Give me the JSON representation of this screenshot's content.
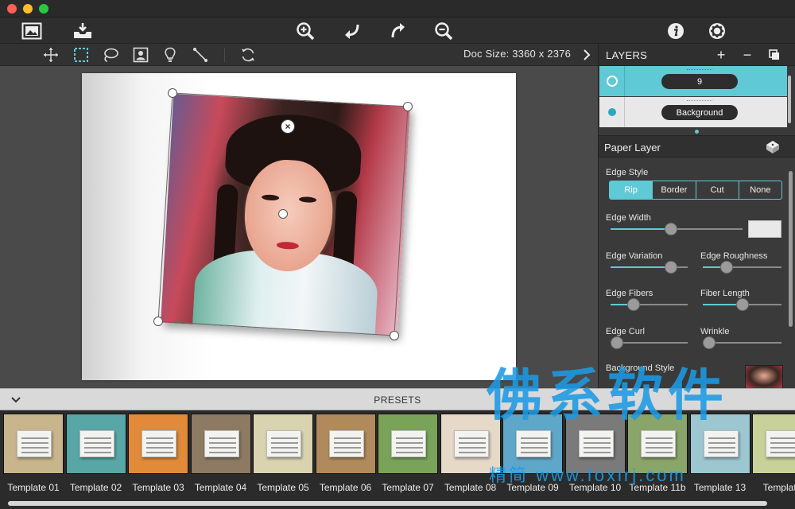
{
  "toolbar": {
    "left_icons": [
      "photo-frame-icon",
      "tray-download-icon"
    ],
    "center_icons": [
      "zoom-in-icon",
      "undo-icon",
      "redo-icon",
      "zoom-out-icon"
    ],
    "right_icons": [
      "info-icon",
      "gear-icon"
    ]
  },
  "subbar": {
    "tools": [
      "move-icon",
      "rect-select-icon",
      "lasso-icon",
      "person-frame-icon",
      "lightbulb-icon",
      "line-icon",
      "rotate-icon"
    ],
    "doc_size_label": "Doc Size:",
    "doc_size_value": "3360 x 2376"
  },
  "layers": {
    "title": "LAYERS",
    "add": "+",
    "remove": "−",
    "items": [
      {
        "name": "9",
        "active": true
      },
      {
        "name": "Background",
        "active": false
      }
    ]
  },
  "paper_layer": {
    "title": "Paper Layer",
    "edge_style_label": "Edge Style",
    "edge_styles": [
      "Rip",
      "Border",
      "Cut",
      "None"
    ],
    "edge_style_selected": "Rip",
    "edge_width_label": "Edge Width",
    "edge_width": 0.46,
    "edge_variation_label": "Edge Variation",
    "edge_variation": 0.78,
    "edge_roughness_label": "Edge Roughness",
    "edge_roughness": 0.3,
    "edge_fibers_label": "Edge Fibers",
    "edge_fibers": 0.3,
    "fiber_length_label": "Fiber Length",
    "fiber_length": 0.5,
    "edge_curl_label": "Edge Curl",
    "edge_curl": 0.08,
    "wrinkle_label": "Wrinkle",
    "wrinkle": 0.08,
    "background_style_label": "Background Style"
  },
  "presets": {
    "title": "PRESETS",
    "templates": [
      {
        "label": "Template 01",
        "bg": "#c9b58c"
      },
      {
        "label": "Template 02",
        "bg": "#58a6a6"
      },
      {
        "label": "Template 03",
        "bg": "#e08a3a"
      },
      {
        "label": "Template 04",
        "bg": "#8d7a63"
      },
      {
        "label": "Template 05",
        "bg": "#d9d3b0"
      },
      {
        "label": "Template 06",
        "bg": "#b08a5a"
      },
      {
        "label": "Template 07",
        "bg": "#7aa35a"
      },
      {
        "label": "Template 08",
        "bg": "#e6d9c8"
      },
      {
        "label": "Template 09",
        "bg": "#5fa7c9"
      },
      {
        "label": "Template 10",
        "bg": "#7a7a7a"
      },
      {
        "label": "Template 11b",
        "bg": "#8aa56a"
      },
      {
        "label": "Template 13",
        "bg": "#9cc7d1"
      },
      {
        "label": "Template",
        "bg": "#c9d19a"
      }
    ]
  },
  "watermark": {
    "text": "佛系软件",
    "url": "精简 www.foxirj.com"
  },
  "colors": {
    "accent": "#5fc9d6",
    "watermark": "#1d9ae2"
  }
}
